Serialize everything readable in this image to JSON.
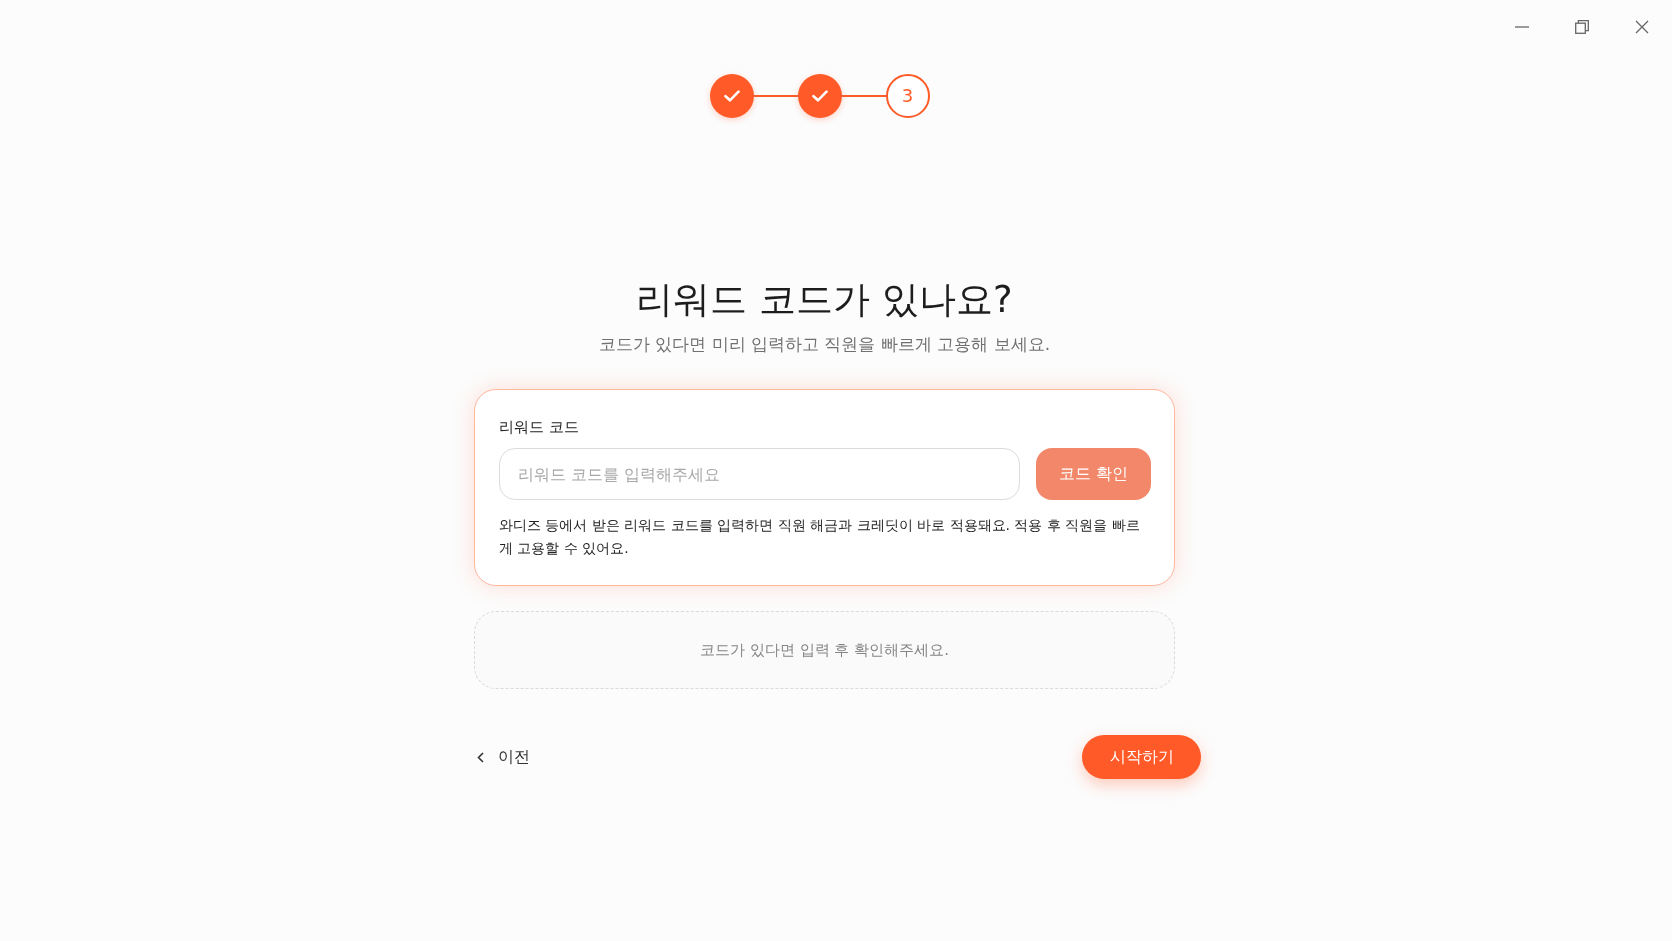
{
  "stepper": {
    "steps": [
      {
        "completed": true
      },
      {
        "completed": true
      },
      {
        "completed": false,
        "number": "3"
      }
    ]
  },
  "heading": {
    "title": "리워드 코드가 있나요?",
    "subtitle": "코드가 있다면 미리 입력하고 직원을 빠르게 고용해 보세요."
  },
  "reward_code_card": {
    "label": "리워드 코드",
    "input": {
      "placeholder": "리워드 코드를 입력해주세요"
    },
    "confirm_button": {
      "label": "코드 확인",
      "disabled": true
    },
    "help_text": "와디즈 등에서 받은 리워드 코드를 입력하면 직원 해금과 크레딧이 바로 적용돼요. 적용 후 직원을 빠르게 고용할 수 있어요."
  },
  "status_box": {
    "message": "코드가 있다면 입력 후 확인해주세요."
  },
  "footer": {
    "back_button": {
      "label": "이전"
    },
    "start_button": {
      "label": "시작하기"
    }
  }
}
